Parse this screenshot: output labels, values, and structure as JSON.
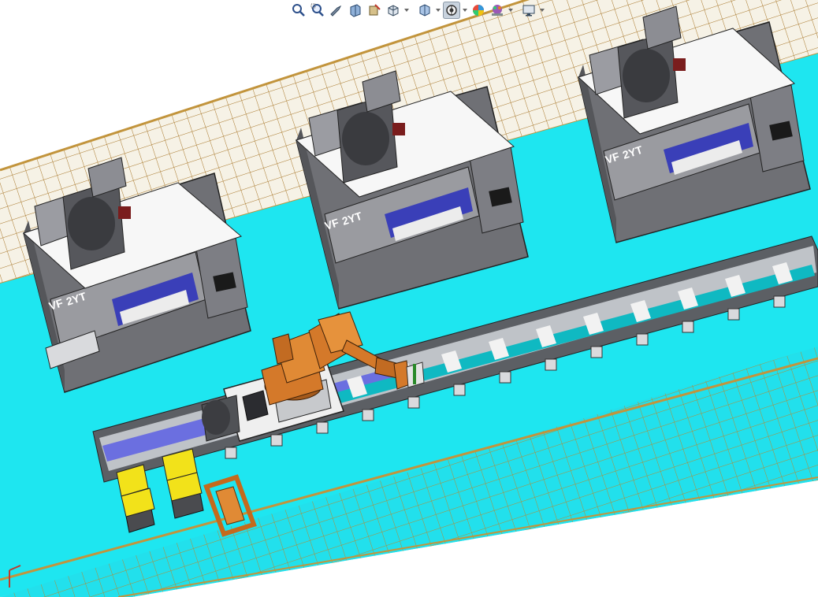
{
  "toolbar": {
    "buttons": [
      {
        "icon": "zoom-to-fit-icon",
        "dropdown": false
      },
      {
        "icon": "zoom-to-area-icon",
        "dropdown": false
      },
      {
        "icon": "previous-view-icon",
        "dropdown": false
      },
      {
        "icon": "section-view-icon",
        "dropdown": false
      },
      {
        "icon": "dynamic-annotation-icon",
        "dropdown": false
      },
      {
        "icon": "view-orientation-icon",
        "dropdown": true
      },
      {
        "icon": "display-style-icon",
        "dropdown": true
      },
      {
        "icon": "hide-show-items-icon",
        "dropdown": true,
        "active": true
      },
      {
        "icon": "edit-appearance-icon",
        "dropdown": false
      },
      {
        "icon": "apply-scene-icon",
        "dropdown": true
      },
      {
        "icon": "view-settings-icon",
        "dropdown": true
      }
    ]
  },
  "machines": [
    {
      "logo": "VF",
      "model": "2YT"
    },
    {
      "logo": "VF",
      "model": "2YT"
    },
    {
      "logo": "VF",
      "model": "2YT"
    }
  ],
  "colors": {
    "floor": "#1ee6f0",
    "fence": "#f6f2e6",
    "fence_grid": "#b8842c",
    "machine_body": "#7c7d82",
    "machine_dark": "#4a4b4f",
    "robot": "#d4792a",
    "rail_white": "#f2f2f2",
    "pallet_yellow": "#f2e21a"
  }
}
